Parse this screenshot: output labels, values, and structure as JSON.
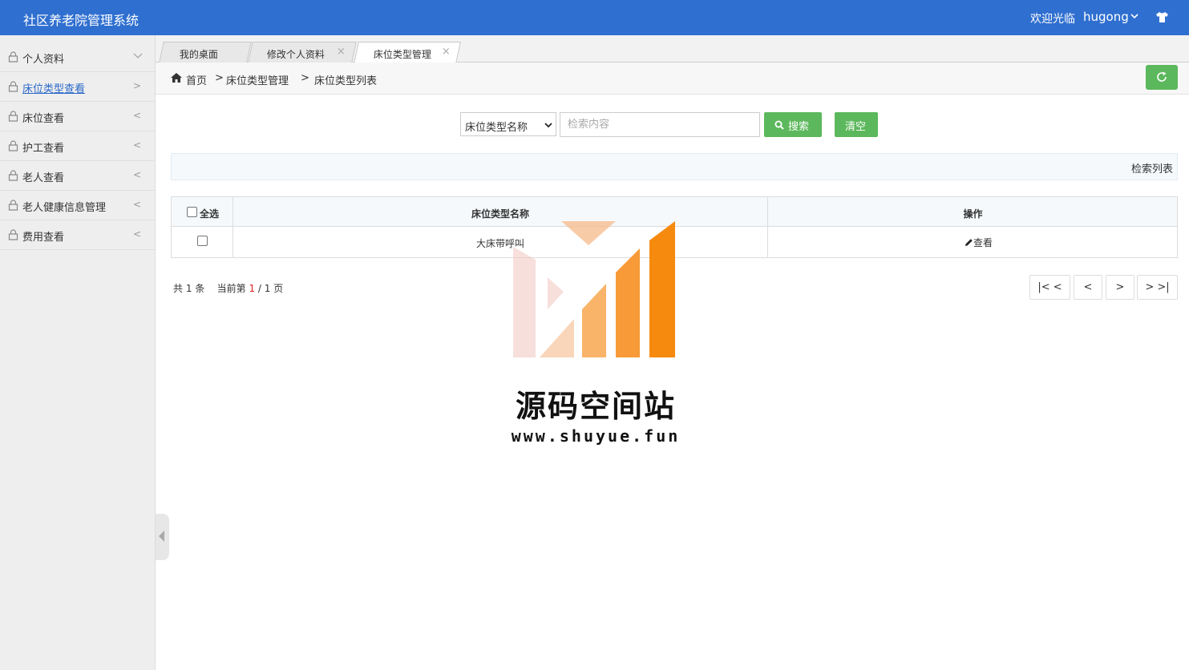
{
  "app": {
    "title": "社区养老院管理系统",
    "welcome": "欢迎光临",
    "username": "hugong"
  },
  "sidebar": {
    "items": [
      {
        "label": "个人资料",
        "arrow": "down"
      },
      {
        "label": "床位类型查看",
        "arrow": ">"
      },
      {
        "label": "床位查看",
        "arrow": "<"
      },
      {
        "label": "护工查看",
        "arrow": "<"
      },
      {
        "label": "老人查看",
        "arrow": "<"
      },
      {
        "label": "老人健康信息管理",
        "arrow": "<"
      },
      {
        "label": "费用查看",
        "arrow": "<"
      }
    ]
  },
  "tabs": [
    {
      "label": "我的桌面",
      "closable": false
    },
    {
      "label": "修改个人资料",
      "closable": true,
      "close": "×"
    },
    {
      "label": "床位类型管理",
      "closable": true,
      "close": "×",
      "active": true
    }
  ],
  "breadcrumb": {
    "home": "首页",
    "sep": ">",
    "level1": "床位类型管理",
    "level2": "床位类型列表"
  },
  "search": {
    "field_selected": "床位类型名称",
    "placeholder": "检索内容",
    "search_label": "搜索",
    "clear_label": "清空"
  },
  "list_title": "检索列表",
  "table": {
    "headers": {
      "select_all": "全选",
      "name": "床位类型名称",
      "action": "操作"
    },
    "rows": [
      {
        "name": "大床带呼叫",
        "action": "查看"
      }
    ]
  },
  "pager": {
    "total_prefix": "共",
    "total": "1",
    "total_suffix": "条",
    "current_prefix": "当前第",
    "current": "1",
    "slash": "/",
    "pages": "1",
    "pages_suffix": "页",
    "first": "|< <",
    "prev": "<",
    "next": ">",
    "last": "> >|"
  },
  "watermark": {
    "title": "源码空间站",
    "url": "www.shuyue.fun"
  },
  "colors": {
    "header": "#2f6fd0",
    "button_green": "#5cb85c",
    "sidebar_bg": "#eeeeee",
    "active_link": "#2a68c8",
    "page_current": "#e02020"
  }
}
